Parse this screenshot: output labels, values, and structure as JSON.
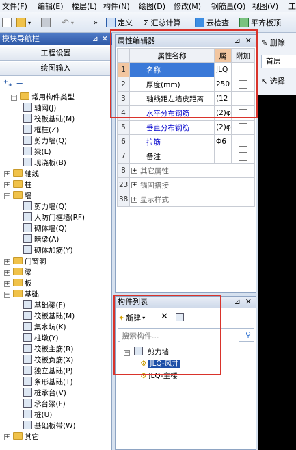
{
  "menu": [
    "文件(F)",
    "编辑(E)",
    "楼层(L)",
    "构件(N)",
    "绘图(D)",
    "修改(M)",
    "钢筋量(Q)",
    "视图(V)",
    "工"
  ],
  "toolbar": {
    "define": "定义",
    "sum": "Σ 汇总计算",
    "cloud_check": "云检查",
    "flat_plate": "平齐板顶",
    "delete": "删除",
    "floor": "首层",
    "select": "选择"
  },
  "nav": {
    "title": "模块导航栏",
    "btn_settings": "工程设置",
    "btn_draw": "绘图输入",
    "tree": [
      {
        "label": "常用构件类型",
        "level": 1,
        "type": "folder",
        "expanded": true
      },
      {
        "label": "轴网(J)",
        "level": 2,
        "type": "item"
      },
      {
        "label": "筏板基础(M)",
        "level": 2,
        "type": "item"
      },
      {
        "label": "框柱(Z)",
        "level": 2,
        "type": "item"
      },
      {
        "label": "剪力墙(Q)",
        "level": 2,
        "type": "item"
      },
      {
        "label": "梁(L)",
        "level": 2,
        "type": "item"
      },
      {
        "label": "现浇板(B)",
        "level": 2,
        "type": "item"
      },
      {
        "label": "轴线",
        "level": 0,
        "type": "folder",
        "expanded": false
      },
      {
        "label": "柱",
        "level": 0,
        "type": "folder",
        "expanded": false
      },
      {
        "label": "墙",
        "level": 0,
        "type": "folder",
        "expanded": true
      },
      {
        "label": "剪力墙(Q)",
        "level": 2,
        "type": "item"
      },
      {
        "label": "人防门框墙(RF)",
        "level": 2,
        "type": "item"
      },
      {
        "label": "砌体墙(Q)",
        "level": 2,
        "type": "item"
      },
      {
        "label": "暗梁(A)",
        "level": 2,
        "type": "item"
      },
      {
        "label": "砌体加筋(Y)",
        "level": 2,
        "type": "item"
      },
      {
        "label": "门窗洞",
        "level": 0,
        "type": "folder",
        "expanded": false
      },
      {
        "label": "梁",
        "level": 0,
        "type": "folder",
        "expanded": false
      },
      {
        "label": "板",
        "level": 0,
        "type": "folder",
        "expanded": false
      },
      {
        "label": "基础",
        "level": 0,
        "type": "folder",
        "expanded": true
      },
      {
        "label": "基础梁(F)",
        "level": 2,
        "type": "item"
      },
      {
        "label": "筏板基础(M)",
        "level": 2,
        "type": "item"
      },
      {
        "label": "集水坑(K)",
        "level": 2,
        "type": "item"
      },
      {
        "label": "柱墩(Y)",
        "level": 2,
        "type": "item"
      },
      {
        "label": "筏板主筋(R)",
        "level": 2,
        "type": "item"
      },
      {
        "label": "筏板负筋(X)",
        "level": 2,
        "type": "item"
      },
      {
        "label": "独立基础(P)",
        "level": 2,
        "type": "item"
      },
      {
        "label": "条形基础(T)",
        "level": 2,
        "type": "item"
      },
      {
        "label": "桩承台(V)",
        "level": 2,
        "type": "item"
      },
      {
        "label": "承台梁(F)",
        "level": 2,
        "type": "item"
      },
      {
        "label": "桩(U)",
        "level": 2,
        "type": "item"
      },
      {
        "label": "基础板带(W)",
        "level": 2,
        "type": "item"
      },
      {
        "label": "其它",
        "level": 0,
        "type": "folder",
        "expanded": false
      }
    ]
  },
  "props": {
    "title": "属性编辑器",
    "headers": {
      "name": "属性名称",
      "value": "属",
      "attach": "附加"
    },
    "rows": [
      {
        "no": "1",
        "name": "名称",
        "value": "JLQ",
        "style": "selected",
        "check": false
      },
      {
        "no": "2",
        "name": "厚度(mm)",
        "value": "250",
        "style": "normal",
        "check": true
      },
      {
        "no": "3",
        "name": "轴线距左墙皮距离",
        "value": "(12",
        "style": "normal",
        "check": true
      },
      {
        "no": "4",
        "name": "水平分布钢筋",
        "value": "(2)φ",
        "style": "blue",
        "check": true
      },
      {
        "no": "5",
        "name": "垂直分布钢筋",
        "value": "(2)φ",
        "style": "blue",
        "check": true
      },
      {
        "no": "6",
        "name": "拉筋",
        "value": "Φ6",
        "style": "blue",
        "check": true
      },
      {
        "no": "7",
        "name": "备注",
        "value": "",
        "style": "normal",
        "check": true
      },
      {
        "no": "8",
        "name": "其它属性",
        "value": "",
        "style": "group",
        "check": false
      },
      {
        "no": "23",
        "name": "锚固搭接",
        "value": "",
        "style": "group",
        "check": false
      },
      {
        "no": "38",
        "name": "显示样式",
        "value": "",
        "style": "group",
        "check": false
      }
    ]
  },
  "complist": {
    "title": "构件列表",
    "new_label": "新建",
    "search_placeholder": "搜索构件...",
    "tree_root": "剪力墙",
    "items": [
      {
        "label": "JLQ-风井",
        "selected": true
      },
      {
        "label": "JLQ-主楼",
        "selected": false
      }
    ]
  }
}
